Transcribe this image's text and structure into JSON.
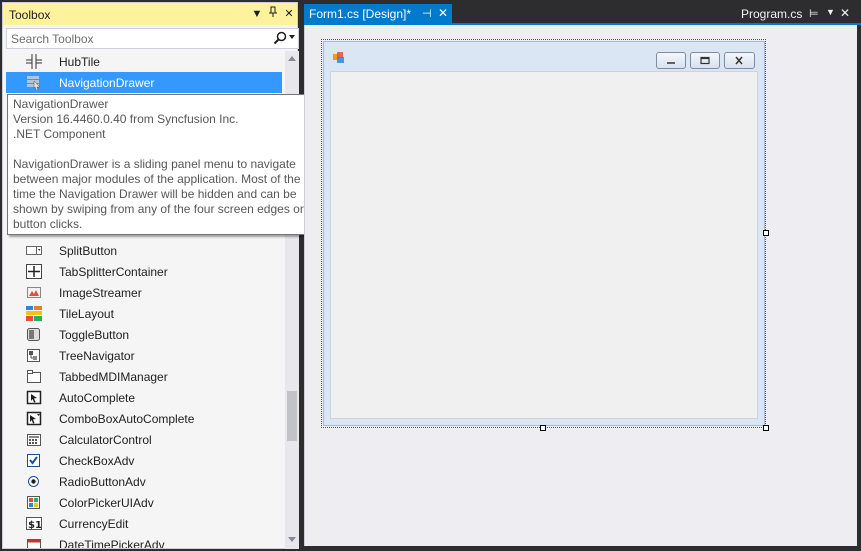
{
  "toolbox": {
    "title": "Toolbox",
    "search_placeholder": "Search Toolbox",
    "items": [
      {
        "label": "HubTile",
        "icon": "hubtile-icon",
        "selected": false
      },
      {
        "label": "NavigationDrawer",
        "icon": "navigation-drawer-icon",
        "selected": true
      },
      {
        "label": "SplitButton",
        "icon": "split-button-icon",
        "selected": false
      },
      {
        "label": "TabSplitterContainer",
        "icon": "tab-splitter-icon",
        "selected": false
      },
      {
        "label": "ImageStreamer",
        "icon": "image-streamer-icon",
        "selected": false
      },
      {
        "label": "TileLayout",
        "icon": "tile-layout-icon",
        "selected": false
      },
      {
        "label": "ToggleButton",
        "icon": "toggle-button-icon",
        "selected": false
      },
      {
        "label": "TreeNavigator",
        "icon": "tree-navigator-icon",
        "selected": false
      },
      {
        "label": "TabbedMDIManager",
        "icon": "tabbed-mdi-icon",
        "selected": false
      },
      {
        "label": "AutoComplete",
        "icon": "autocomplete-icon",
        "selected": false
      },
      {
        "label": "ComboBoxAutoComplete",
        "icon": "combobox-autocomplete-icon",
        "selected": false
      },
      {
        "label": "CalculatorControl",
        "icon": "calculator-icon",
        "selected": false
      },
      {
        "label": "CheckBoxAdv",
        "icon": "checkbox-icon",
        "selected": false
      },
      {
        "label": "RadioButtonAdv",
        "icon": "radio-button-icon",
        "selected": false
      },
      {
        "label": "ColorPickerUIAdv",
        "icon": "color-picker-icon",
        "selected": false
      },
      {
        "label": "CurrencyEdit",
        "icon": "currency-icon",
        "selected": false
      },
      {
        "label": "DateTimePickerAdv",
        "icon": "datetime-picker-icon",
        "selected": false
      }
    ]
  },
  "tooltip": {
    "lines": [
      "NavigationDrawer",
      "Version 16.4460.0.40 from Syncfusion Inc.",
      ".NET Component",
      "",
      "NavigationDrawer is a sliding panel menu to navigate",
      "between major modules of the application.  Most of the",
      "time the Navigation Drawer will be hidden and can be",
      "shown by swiping from any of the four screen edges or",
      "button clicks."
    ]
  },
  "tabs": {
    "active": "Form1.cs [Design]*",
    "other": "Program.cs"
  },
  "colors": {
    "accent": "#007acc",
    "title_highlight": "#fff29d",
    "selection": "#3399ff"
  }
}
